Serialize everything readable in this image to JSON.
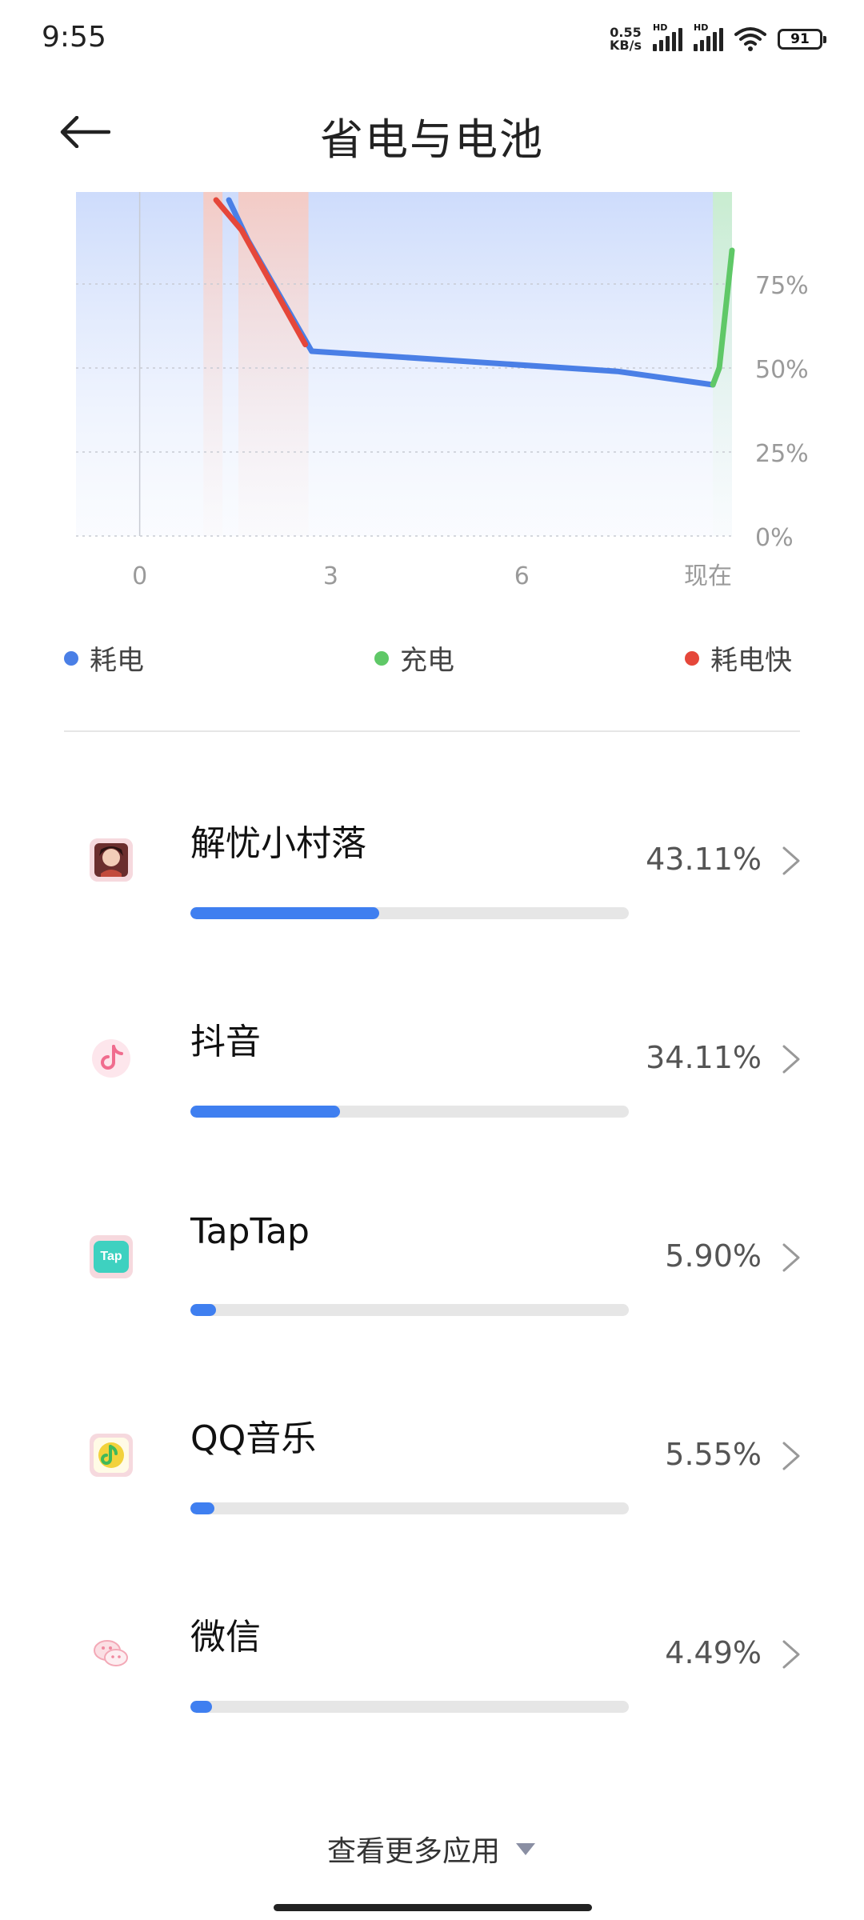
{
  "status_bar": {
    "time": "9:55",
    "net_speed_value": "0.55",
    "net_speed_unit": "KB/s",
    "sim1_label": "HD",
    "sim2_label": "HD",
    "battery": "91"
  },
  "header": {
    "title": "省电与电池"
  },
  "chart_data": {
    "type": "area",
    "x_ticks": [
      "0",
      "3",
      "6",
      "现在"
    ],
    "y_ticks": [
      "75%",
      "50%",
      "25%",
      "0%"
    ],
    "ylim": [
      0,
      100
    ],
    "series": [
      {
        "name": "耗电",
        "color": "#4a7fe6",
        "points": [
          [
            1.4,
            100
          ],
          [
            1.7,
            88
          ],
          [
            2.7,
            55
          ],
          [
            7.5,
            49
          ],
          [
            9.0,
            45
          ]
        ]
      },
      {
        "name": "耗电快",
        "color": "#e5473a",
        "points": [
          [
            1.2,
            100
          ],
          [
            1.6,
            91
          ],
          [
            2.6,
            57
          ]
        ]
      },
      {
        "name": "充电",
        "color": "#5fc867",
        "points": [
          [
            9.0,
            45
          ],
          [
            9.1,
            50
          ],
          [
            9.3,
            85
          ]
        ]
      }
    ],
    "legend": [
      {
        "label": "耗电",
        "color": "#4a7fe6"
      },
      {
        "label": "充电",
        "color": "#5fc867"
      },
      {
        "label": "耗电快",
        "color": "#e5473a"
      }
    ]
  },
  "apps": [
    {
      "name": "解忧小村落",
      "percent": "43.11%",
      "usage": 0.4311,
      "icon": "game-avatar-icon"
    },
    {
      "name": "抖音",
      "percent": "34.11%",
      "usage": 0.3411,
      "icon": "douyin-icon"
    },
    {
      "name": "TapTap",
      "percent": "5.90%",
      "usage": 0.059,
      "icon_text": "Tap",
      "icon": "taptap-icon"
    },
    {
      "name": "QQ音乐",
      "percent": "5.55%",
      "usage": 0.0555,
      "icon": "qq-music-icon"
    },
    {
      "name": "微信",
      "percent": "4.49%",
      "usage": 0.0449,
      "icon": "wechat-icon"
    }
  ],
  "footer": {
    "more_label": "查看更多应用"
  }
}
